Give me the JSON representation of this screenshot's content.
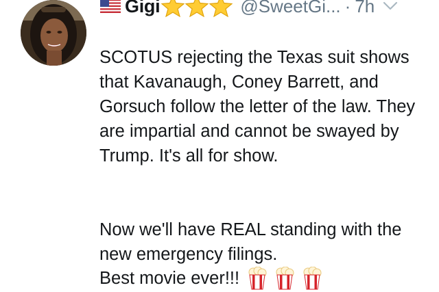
{
  "tweet": {
    "display_name": "Gigi",
    "handle": "@SweetGi...",
    "separator": "·",
    "time": "7h",
    "icons": {
      "flag": "us-flag-icon",
      "stars": [
        "star-icon",
        "star-icon",
        "star-icon"
      ],
      "menu": "chevron-down-icon",
      "popcorn": [
        "popcorn-icon",
        "popcorn-icon",
        "popcorn-icon"
      ]
    },
    "paragraph_1": "SCOTUS rejecting the Texas suit shows that Kavanaugh, Coney Barrett, and Gorsuch follow the letter of the law.  They are impartial and cannot be swayed by Trump. It's all for show.",
    "paragraph_2": "Now we'll have REAL standing with the new emergency filings.",
    "paragraph_3": "Best movie ever!!!"
  }
}
